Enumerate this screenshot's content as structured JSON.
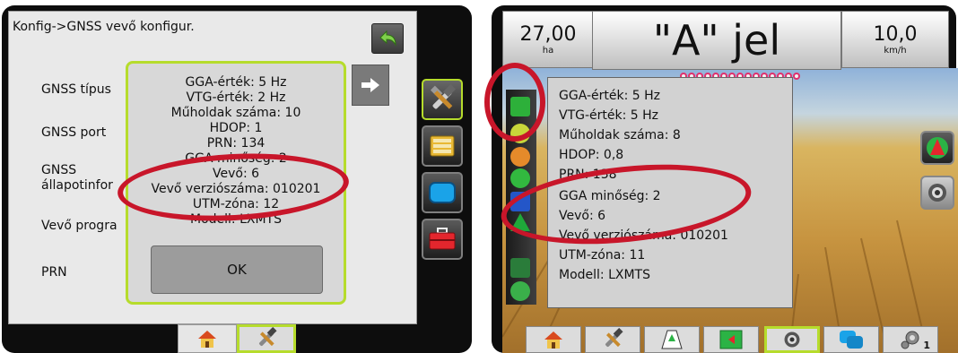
{
  "left_screen": {
    "title": "Konfig->GNSS vevő konfigur.",
    "settings_rows": [
      {
        "label": "GNSS típus"
      },
      {
        "label": "GNSS port"
      },
      {
        "label": "GNSS\nállapotinfor"
      },
      {
        "label": "Vevő progra"
      },
      {
        "label": "PRN"
      }
    ],
    "popup": {
      "lines": [
        "GGA-érték: 5 Hz",
        "VTG-érték: 2 Hz",
        "Műholdak száma: 10",
        "HDOP: 1",
        "PRN: 134",
        "GGA minőség: 2",
        "Vevő: 6",
        "Vevő verziószáma: 010201",
        "UTM-zóna: 12",
        "Modell: LXMTS"
      ],
      "ok_label": "OK"
    },
    "sidebar_icons": [
      "wrench-hammer-icon",
      "data-cards-icon",
      "display-icon",
      "toolbox-icon"
    ],
    "bottom_tabs": [
      "home-icon",
      "tools-icon"
    ]
  },
  "right_screen": {
    "area_value": "27,00",
    "area_unit": "ha",
    "center_title": "\"A\" jel",
    "speed_value": "10,0",
    "speed_unit": "km/h",
    "lightbar_leds": 15,
    "popup_lines": [
      "GGA-érték: 5 Hz",
      "VTG-érték: 5 Hz",
      "Műholdak száma: 8",
      "HDOP: 0,8",
      "PRN: 138",
      "GGA minőség: 2",
      "Vevő: 6",
      "Vevő verziószáma: 010201",
      "UTM-zóna: 11",
      "Modell: LXMTS"
    ],
    "left_sidebar_icons": [
      "gnss-status-icon",
      "pattern-icon",
      "guidance-icon",
      "steering-icon",
      "implement-icon",
      "triangle-icon",
      "boom-icon",
      "settings-gear-icon"
    ],
    "right_side_icons": [
      "navigation-arrow-icon",
      "camera-icon"
    ],
    "bottom_tabs": [
      "home-icon",
      "tools-icon",
      "guidance-view-icon",
      "field-map-icon",
      "camera-icon",
      "display-swap-icon",
      "gear-count-icon"
    ],
    "badge_count": "1"
  },
  "highlight_color": "#c8162a",
  "accent_color": "#b6dc2c"
}
